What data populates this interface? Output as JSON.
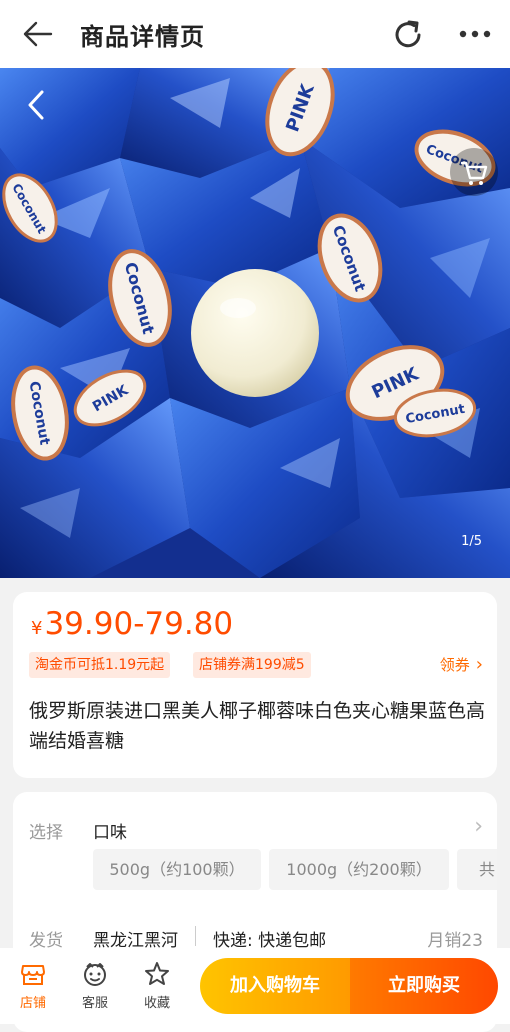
{
  "header": {
    "title": "商品详情页",
    "back_icon": "arrow-left-icon",
    "refresh_icon": "refresh-icon",
    "more_icon": "more-dots-icon"
  },
  "gallery": {
    "index_label": "1/5",
    "back_icon": "chevron-left-icon",
    "cart_icon": "cart-icon",
    "wrapper_text_1": "PINK",
    "wrapper_text_2": "Coconut"
  },
  "product": {
    "currency": "¥",
    "price_range": "39.90-79.80",
    "tags": [
      "淘金币可抵1.19元起",
      "店铺券满199减5"
    ],
    "coupon_link": "领券",
    "title": "俄罗斯原装进口黑美人椰子椰蓉味白色夹心糖果蓝色高端结婚喜糖"
  },
  "options": {
    "select_label": "选择",
    "option_group": "口味",
    "choices": [
      "500g（约100颗）",
      "1000g（约200颗）",
      "共"
    ],
    "ship_label": "发货",
    "ship_place": "黑龙江黑河",
    "ship_method": "快递: 快递包邮",
    "monthly_sales": "月销23"
  },
  "bottom_bar": {
    "tabs": [
      {
        "label": "店铺",
        "icon": "store-icon"
      },
      {
        "label": "客服",
        "icon": "customer-service-icon"
      },
      {
        "label": "收藏",
        "icon": "star-icon"
      }
    ],
    "add_to_cart": "加入购物车",
    "buy_now": "立即购买"
  },
  "colors": {
    "accent": "#ff4c00",
    "tag_bg": "#ffe9e0",
    "cart_btn": "#ffb000",
    "buy_btn": "#ff5a00",
    "photo_blue": "#1c3fa8"
  }
}
